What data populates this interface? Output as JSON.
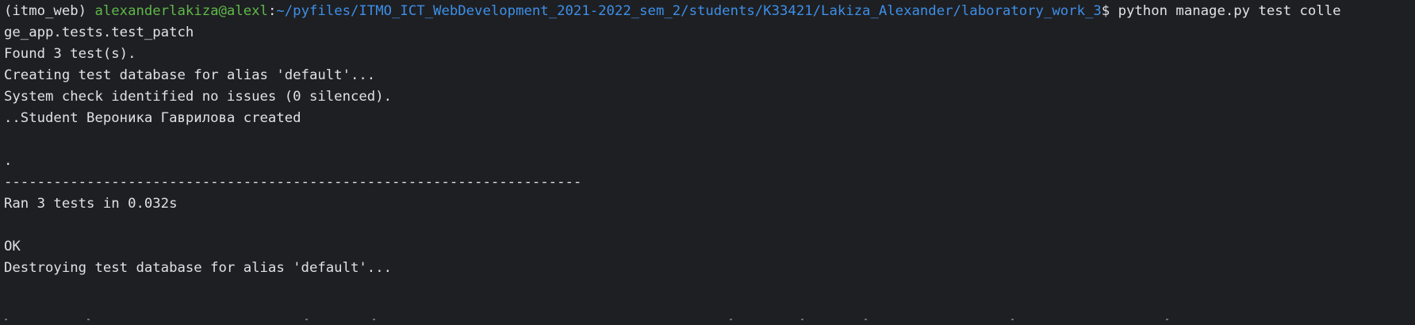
{
  "terminal": {
    "prompt": {
      "env": "(itmo_web) ",
      "user_host": "alexanderlakiza@alexl",
      "separator": ":",
      "path": "~/pyfiles/ITMO_ICT_WebDevelopment_2021-2022_sem_2/students/K33421/Lakiza_Alexander/laboratory_work_3",
      "dollar": "$ ",
      "command": "python manage.py test colle"
    },
    "lines": [
      "ge_app.tests.test_patch",
      "Found 3 test(s).",
      "Creating test database for alias 'default'...",
      "System check identified no issues (0 silenced).",
      "..Student Вероника Гаврилова created",
      "",
      ".",
      "----------------------------------------------------------------------",
      "Ran 3 tests in 0.032s",
      "",
      "OK",
      "Destroying test database for alias 'default'..."
    ]
  },
  "colors": {
    "background": "#1e1f22",
    "text": "#dfe1e5",
    "user_host": "#5fb84a",
    "path": "#3d8fe8"
  }
}
